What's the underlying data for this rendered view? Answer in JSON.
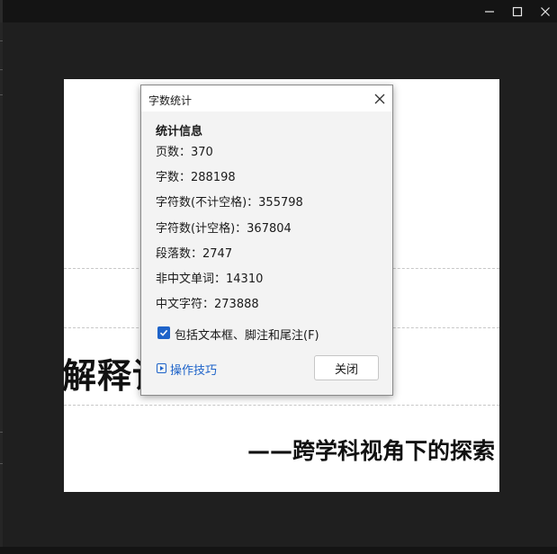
{
  "window": {
    "minimize_label": "—",
    "maximize_label": "□",
    "close_label": "✕"
  },
  "document": {
    "title_fragment": "解释论",
    "subtitle": "——跨学科视角下的探索"
  },
  "dialog": {
    "title": "字数统计",
    "section_title": "统计信息",
    "stats": [
      {
        "label": "页数：",
        "value": "370"
      },
      {
        "label": "字数：",
        "value": "288198"
      },
      {
        "label": "字符数(不计空格)：",
        "value": "355798"
      },
      {
        "label": "字符数(计空格)：",
        "value": "367804"
      },
      {
        "label": "段落数：",
        "value": "2747"
      },
      {
        "label": "非中文单词：",
        "value": "14310"
      },
      {
        "label": "中文字符：",
        "value": "273888"
      }
    ],
    "checkbox_label": "包括文本框、脚注和尾注(F)",
    "checkbox_checked": true,
    "tips_link": "操作技巧",
    "close_button": "关闭"
  },
  "colors": {
    "accent": "#1e63c9",
    "app_background": "#1f1f1f",
    "titlebar": "#141414"
  },
  "icons": {
    "minimize": "minimize-icon",
    "maximize": "maximize-icon",
    "close": "close-icon",
    "checkbox": "checkmark-icon",
    "tips": "play-square-icon"
  }
}
